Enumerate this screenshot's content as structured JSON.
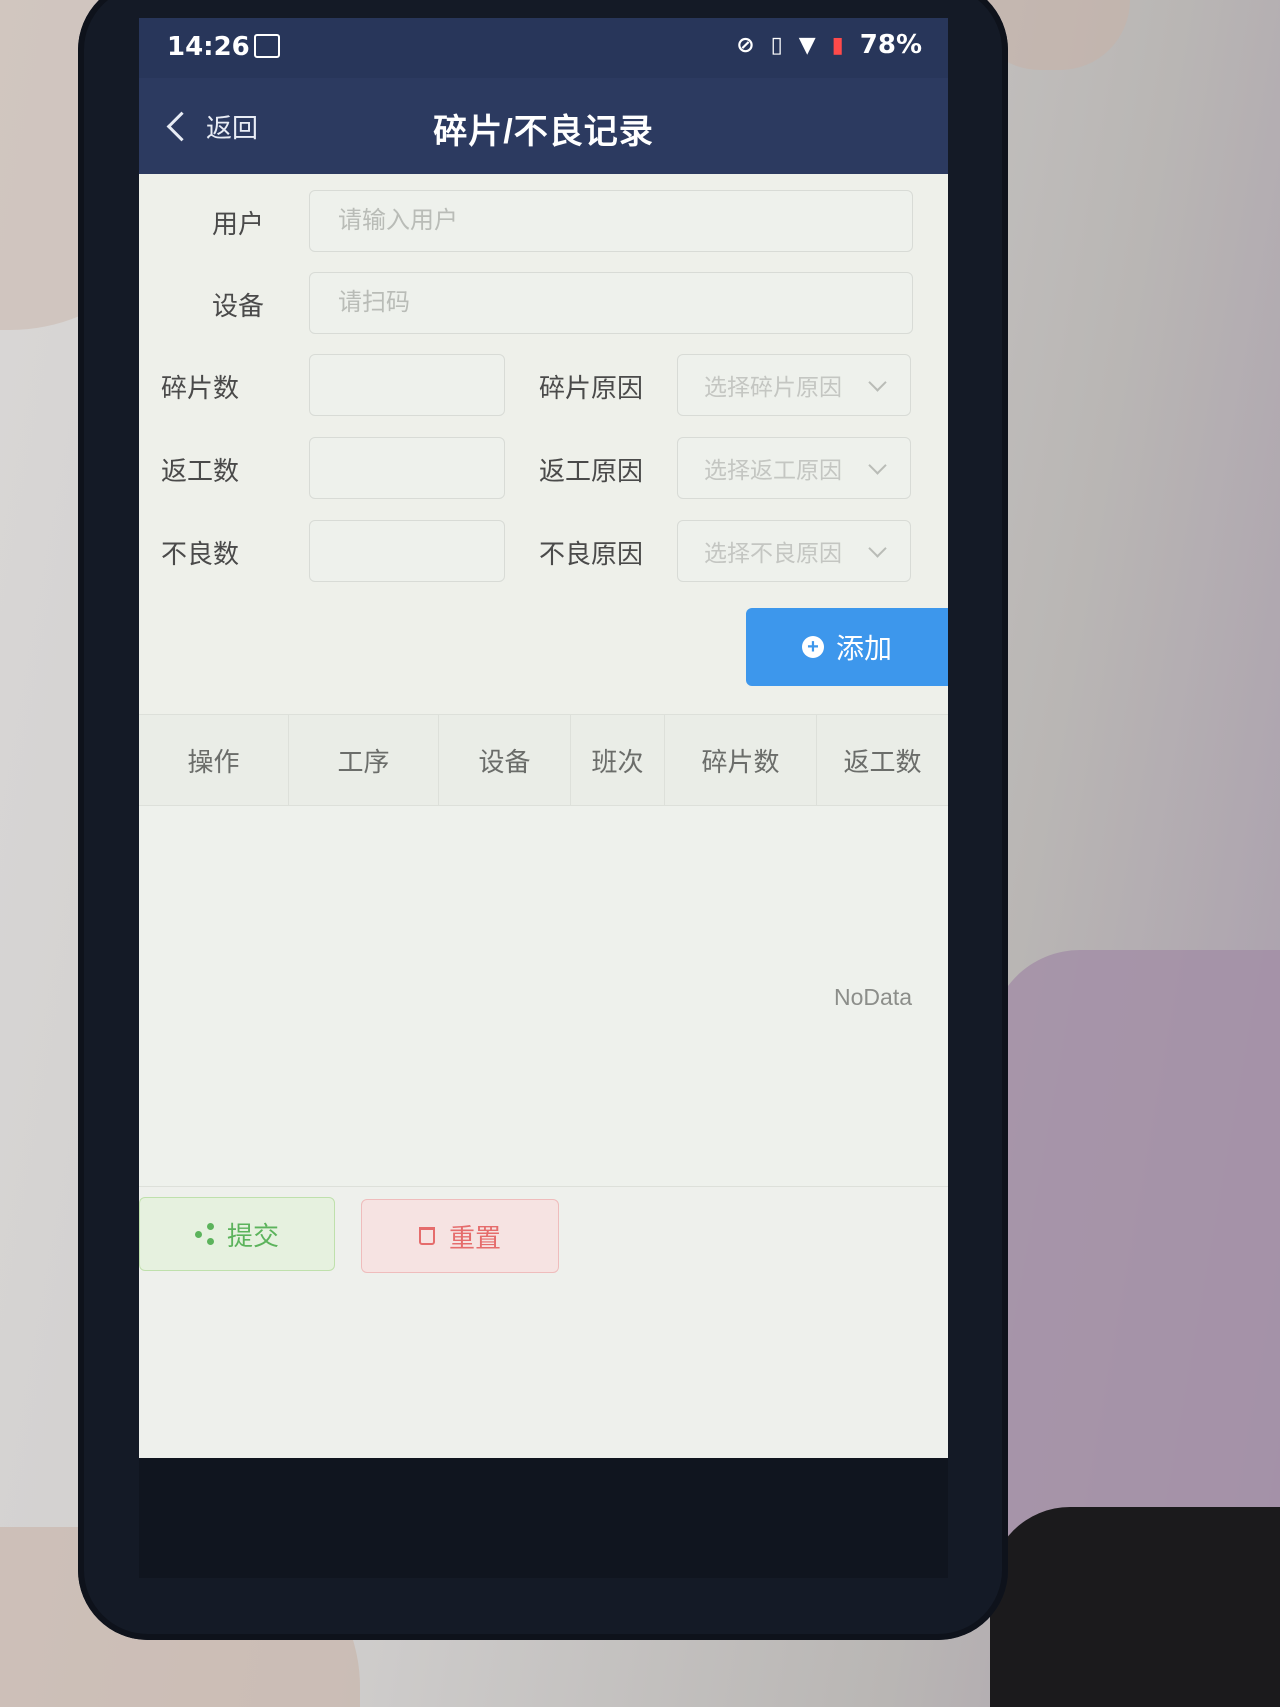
{
  "status_bar": {
    "time": "14:26",
    "battery": "78%",
    "icons": [
      "sim-card-icon",
      "no-sim-icon",
      "vibrate-icon",
      "wifi-icon",
      "battery-icon"
    ]
  },
  "nav": {
    "back_label": "返回",
    "title": "碎片/不良记录"
  },
  "form": {
    "user_label": "用户",
    "user_placeholder": "请输入用户",
    "user_value": "",
    "device_label": "设备",
    "device_placeholder": "请扫码",
    "device_value": "",
    "fragment_count_label": "碎片数",
    "fragment_count_value": "",
    "fragment_reason_label": "碎片原因",
    "fragment_reason_placeholder": "选择碎片原因",
    "rework_count_label": "返工数",
    "rework_count_value": "",
    "rework_reason_label": "返工原因",
    "rework_reason_placeholder": "选择返工原因",
    "defect_count_label": "不良数",
    "defect_count_value": "",
    "defect_reason_label": "不良原因",
    "defect_reason_placeholder": "选择不良原因",
    "add_label": "添加"
  },
  "table": {
    "columns": [
      "操作",
      "工序",
      "设备",
      "班次",
      "碎片数",
      "返工数"
    ],
    "rows": [],
    "empty_text": "NoData"
  },
  "actions": {
    "submit_label": "提交",
    "reset_label": "重置"
  },
  "colors": {
    "header_bg": "#2c3a60",
    "add_button": "#3d97ec",
    "submit_green": "#5cb35c",
    "reset_red": "#e56c6c"
  }
}
